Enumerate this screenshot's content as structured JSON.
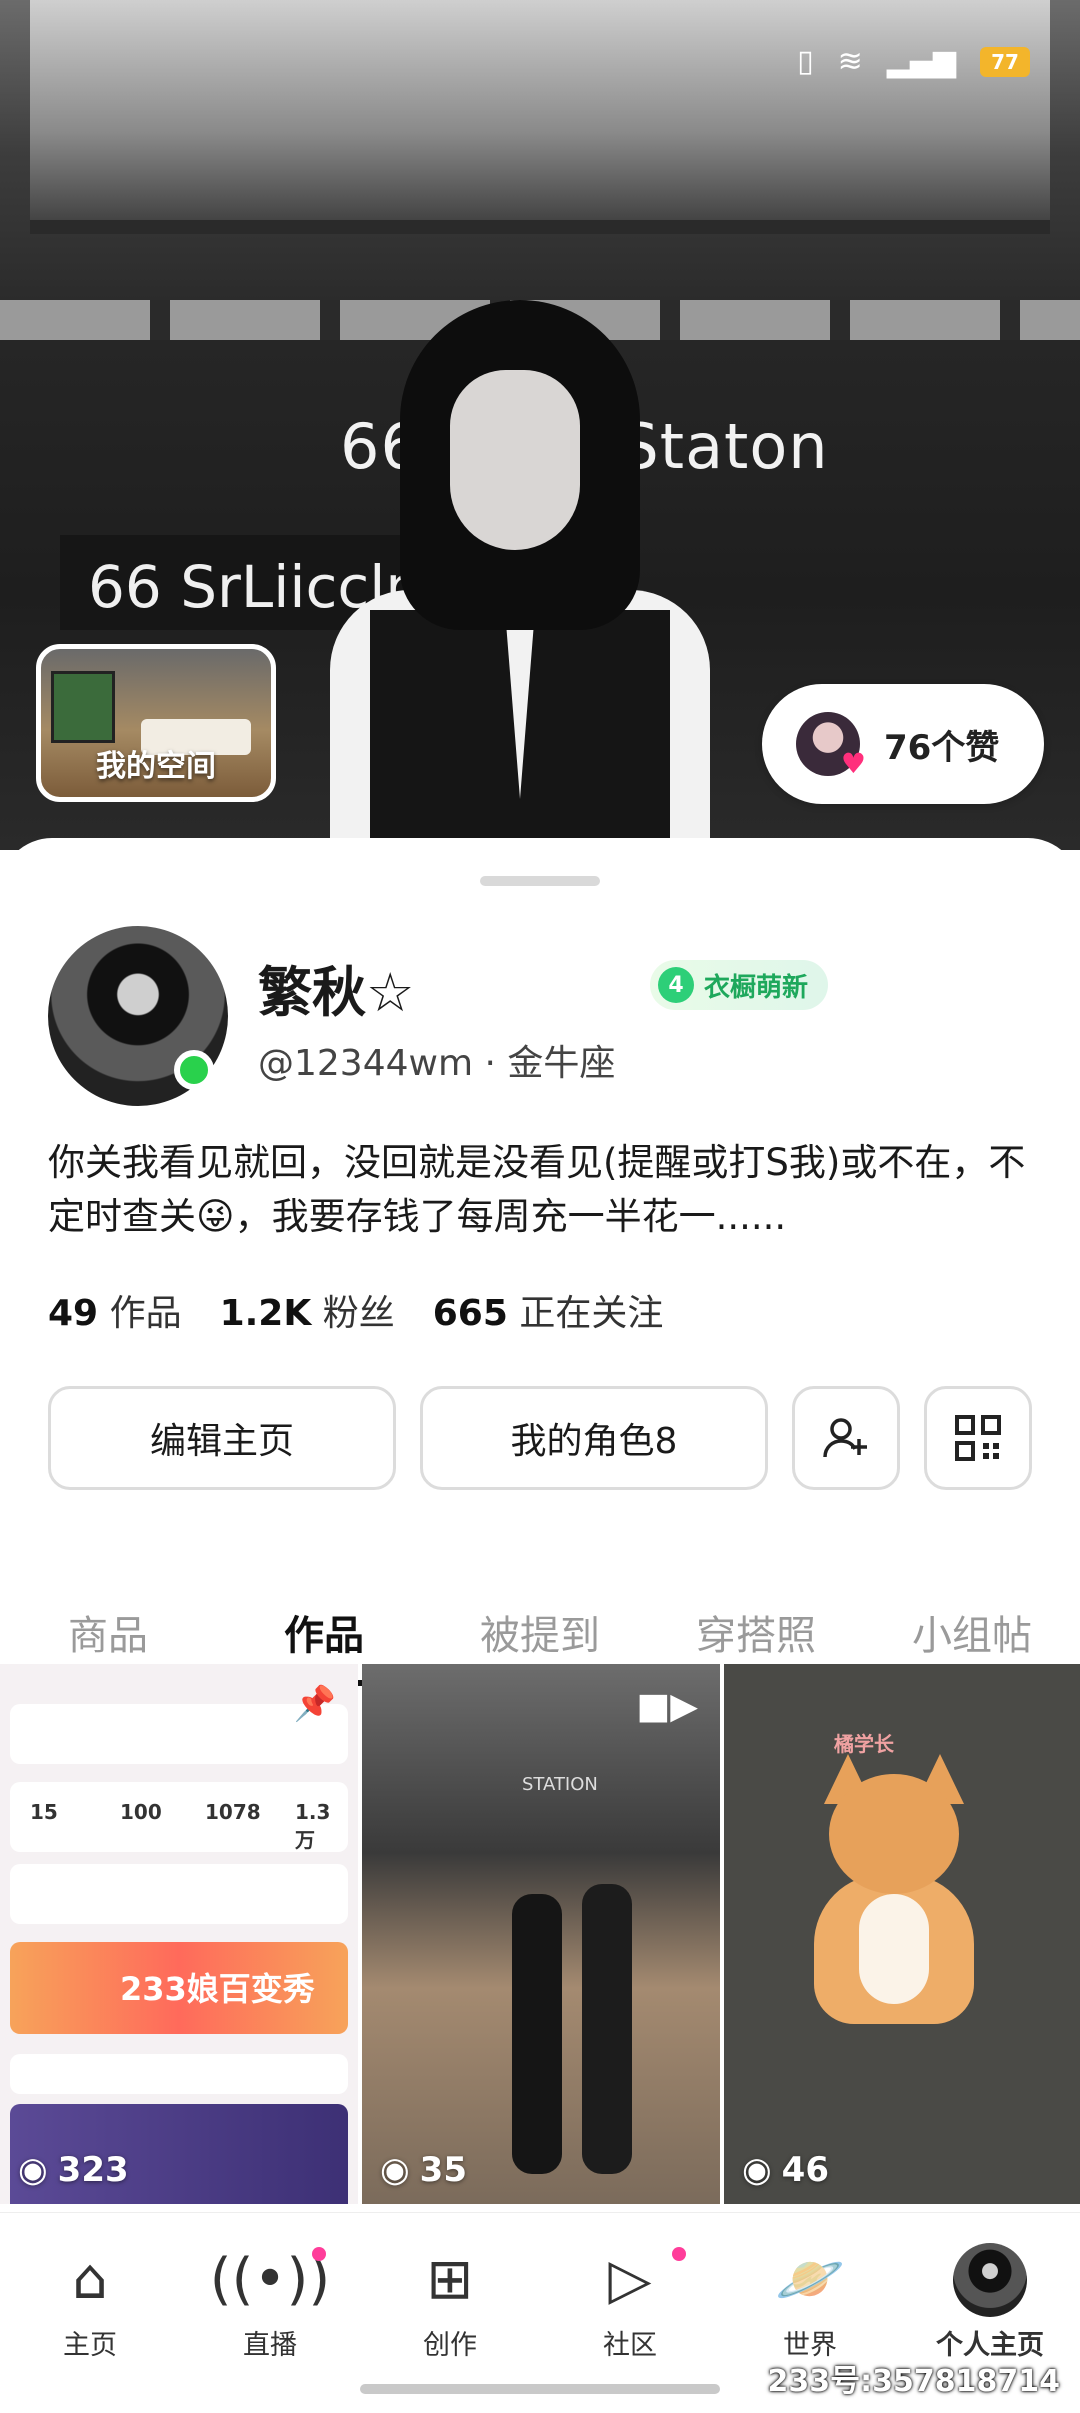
{
  "status_bar": {
    "battery": "77"
  },
  "hero": {
    "sign_top": "66 n Ctr Staton",
    "sign_left": "66 SrLiiccln",
    "my_space_label": "我的空间",
    "likes_text": "76个赞"
  },
  "profile": {
    "nickname": "繁秋☆",
    "badge_level": "4",
    "badge_text": "衣橱萌新",
    "id_line": "@12344wm · 金牛座",
    "bio": "你关我看见就回，没回就是没看见(提醒或打S我)或不在，不定时查关😜，我要存钱了每周充一半花一......",
    "stats": [
      {
        "value": "49",
        "label": "作品"
      },
      {
        "value": "1.2K",
        "label": "粉丝"
      },
      {
        "value": "665",
        "label": "正在关注"
      }
    ]
  },
  "buttons": {
    "edit": "编辑主页",
    "role": "我的角色8"
  },
  "tabs": [
    "商品",
    "作品",
    "被提到",
    "穿搭照",
    "小组帖"
  ],
  "active_tab": "作品",
  "posts": [
    {
      "views": "323",
      "type": "pinned",
      "preview": {
        "nums": [
          "15",
          "100",
          "1078",
          "1.3万"
        ],
        "banner": "233娘百变秀"
      }
    },
    {
      "views": "35",
      "type": "video",
      "preview": {
        "sign": "STATION"
      }
    },
    {
      "views": "46",
      "type": "image",
      "preview": {
        "label": "橘学长"
      }
    }
  ],
  "nav": [
    "主页",
    "直播",
    "创作",
    "社区",
    "世界",
    "个人主页"
  ],
  "watermark": "233号:357818714",
  "colors": {
    "accent_green": "#29d14c",
    "badge_green": "#1ea85c",
    "notification_pink": "#ff3d9a",
    "battery": "#f3b52b"
  },
  "icons": {
    "add_friend": "person-plus-icon",
    "qr": "qr-code-icon",
    "views": "eye-icon",
    "pin": "pin-icon",
    "video": "video-camera-icon"
  }
}
